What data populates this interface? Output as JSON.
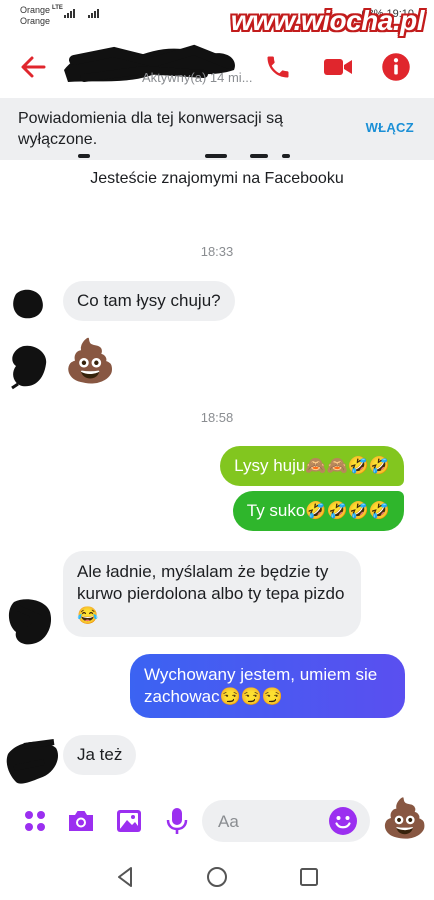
{
  "status_bar": {
    "carrier_1": "Orange",
    "carrier_2": "Orange",
    "network": "LTE",
    "battery": "63%",
    "time": "19:10"
  },
  "watermark": "www.wiocha.pl",
  "header": {
    "status": "Aktywny(a) 14 mi...",
    "icons": [
      "back-arrow-icon",
      "phone-icon",
      "video-camera-icon",
      "info-icon"
    ],
    "accent": "#e0262d"
  },
  "banner": {
    "text": "Powiadomienia dla tej konwersacji są wyłączone.",
    "button": "WŁĄCZ"
  },
  "conversation": {
    "friends_notice": "Jesteście znajomymi na Facebooku",
    "timestamps": [
      "18:33",
      "18:58"
    ],
    "messages": [
      {
        "side": "in",
        "text": "Co tam łysy chuju?"
      },
      {
        "side": "in",
        "text": "💩"
      },
      {
        "side": "out",
        "text": "Lysy huju🙈🙈🤣🤣"
      },
      {
        "side": "out",
        "text": "Ty suko🤣🤣🤣🤣"
      },
      {
        "side": "in",
        "text": "Ale ładnie, myślalam że będzie ty kurwo pierdolona albo ty tepa pizdo 😂"
      },
      {
        "side": "out",
        "text": "Wychowany jestem, umiem sie zachowac😏😏😏"
      },
      {
        "side": "in",
        "text": "Ja też"
      }
    ],
    "colors": {
      "incoming_bg": "#eeeff1",
      "outgoing_green_top": "#82c61f",
      "outgoing_green_bottom": "#2fb62c",
      "outgoing_blue": "#4a5af0"
    }
  },
  "composer": {
    "placeholder": "Aa",
    "icons": [
      "apps-icon",
      "camera-icon",
      "gallery-icon",
      "microphone-icon",
      "emoji-icon"
    ],
    "quick_reaction": "💩",
    "accent": "#9b2ff0"
  },
  "navbar": {
    "icons": [
      "back-triangle-icon",
      "home-circle-icon",
      "recents-square-icon"
    ]
  }
}
